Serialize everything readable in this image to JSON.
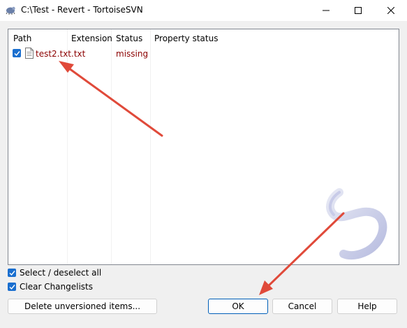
{
  "window": {
    "title": "C:\\Test - Revert - TortoiseSVN",
    "minimize_icon": "minimize-icon",
    "maximize_icon": "maximize-icon",
    "close_icon": "close-icon"
  },
  "list": {
    "columns": [
      "Path",
      "Extension",
      "Status",
      "Property status"
    ],
    "rows": [
      {
        "checked": true,
        "path": "test2.txt",
        "extension": ".txt",
        "status": "missing",
        "property_status": ""
      }
    ]
  },
  "options": {
    "select_all_label": "Select / deselect all",
    "select_all_checked": true,
    "clear_changelists_label": "Clear Changelists",
    "clear_changelists_checked": true
  },
  "buttons": {
    "delete_unversioned": "Delete unversioned items...",
    "ok": "OK",
    "cancel": "Cancel",
    "help": "Help"
  },
  "colors": {
    "accent": "#1a6fcf",
    "arrow": "#e04a3a",
    "status_text": "#8b0000"
  }
}
